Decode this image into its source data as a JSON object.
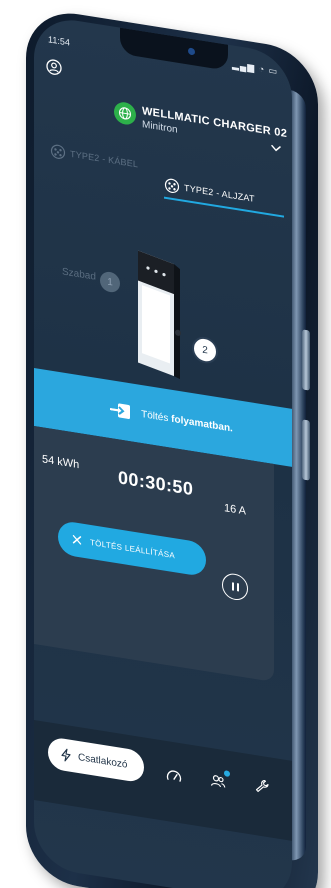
{
  "status_bar": {
    "time": "11:54",
    "icons": "▂▄▆ ◔ ▭"
  },
  "header": {
    "charger_name": "WELLMATIC CHARGER 02",
    "charger_owner": "Minitron"
  },
  "tabs": [
    {
      "label": "TYPE2 - KÁBEL",
      "active": false
    },
    {
      "label": "TYPE2 - ALJZAT",
      "active": true
    }
  ],
  "connectors": {
    "socket_1_label": "Szabad",
    "socket_1_number": "1",
    "socket_2_number": "2"
  },
  "charging": {
    "status_prefix": "Töltés",
    "status_emphasis": "folyamatban.",
    "energy": "54 kWh",
    "duration": "00:30:50",
    "current": "16 A",
    "stop_label": "TÖLTÉS LEÁLLÍTÁSA"
  },
  "bottom_nav": {
    "active_label": "Csatlakozó"
  },
  "colors": {
    "accent": "#21a9e1",
    "screen_bg": "#22364b",
    "panel_bg": "#2c3d4f",
    "logo_green": "#2db04a"
  }
}
